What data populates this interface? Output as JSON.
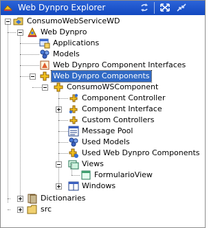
{
  "window": {
    "title": "Web Dynpro Explorer"
  },
  "toolbar": {
    "sync_icon": "sync-icon",
    "maximize_icon": "maximize-icon",
    "minimize_icon": "minimize-icon"
  },
  "tree": {
    "root": "ConsumoWebServiceWD",
    "web_dynpro": "Web Dynpro",
    "applications": "Applications",
    "models": "Models",
    "component_interfaces": "Web Dynpro Component Interfaces",
    "components": "Web Dynpro Components",
    "component": "ConsumoWSComponent",
    "component_controller": "Component Controller",
    "component_interface": "Component Interface",
    "custom_controllers": "Custom Controllers",
    "message_pool": "Message Pool",
    "used_models": "Used Models",
    "used_components": "Used Web Dynpro Components",
    "views": "Views",
    "formulario_view": "FormularioView",
    "windows": "Windows",
    "dictionaries": "Dictionaries",
    "src": "src"
  },
  "colors": {
    "titlebar": "#1e56cc",
    "selection": "#316ac5"
  }
}
